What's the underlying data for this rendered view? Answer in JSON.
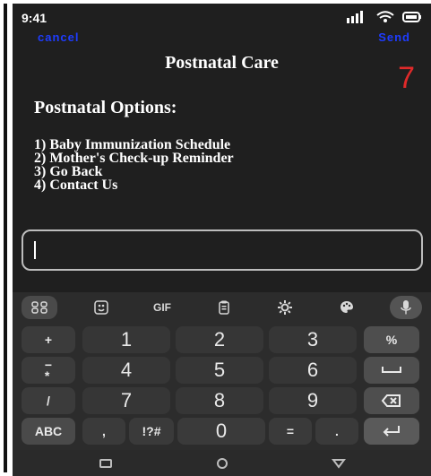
{
  "status_bar": {
    "time": "9:41"
  },
  "header": {
    "cancel": "cancel",
    "send": "Send",
    "title": "Postnatal Care",
    "counter": "7"
  },
  "content": {
    "subtitle": "Postnatal Options:",
    "options": [
      "1) Baby Immunization Schedule",
      "2) Mother's Check-up Reminder",
      "3) Go Back",
      "4) Contact Us"
    ]
  },
  "keyboard": {
    "toolbar": [
      "apps-icon",
      "emoji-icon",
      "GIF",
      "clipboard-icon",
      "settings-icon",
      "palette-icon",
      "mic-icon"
    ],
    "rows": [
      {
        "side": "+",
        "keys": [
          "1",
          "2",
          "3"
        ],
        "right": "%"
      },
      {
        "side": "−\n*",
        "keys": [
          "4",
          "5",
          "6"
        ],
        "right": "space-icon"
      },
      {
        "side": "/",
        "keys": [
          "7",
          "8",
          "9"
        ],
        "right": "backspace-icon"
      }
    ],
    "bottom": {
      "abc": "ABC",
      "comma": ",",
      "symbols": "!?#",
      "zero": "0",
      "equals": "=",
      "dot": ".",
      "enter": "enter-icon"
    }
  },
  "nav": {
    "icons": [
      "recent-apps-icon",
      "home-icon",
      "back-icon"
    ]
  }
}
